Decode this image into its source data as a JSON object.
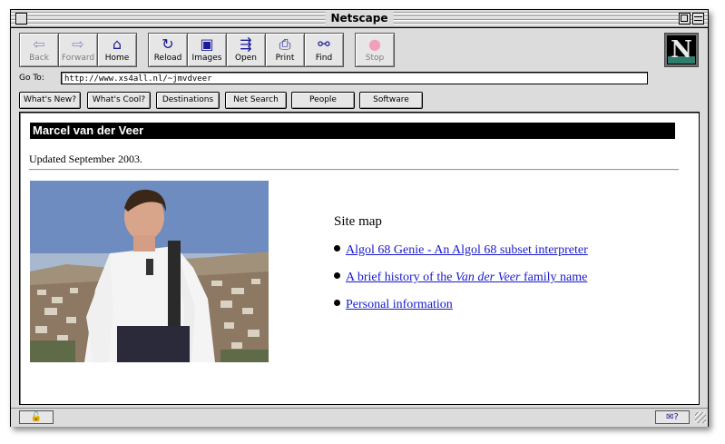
{
  "window": {
    "title": "Netscape"
  },
  "toolbar": {
    "buttons": [
      {
        "label": "Back",
        "icon": "back-arrow-icon",
        "glyph": "⇦"
      },
      {
        "label": "Forward",
        "icon": "forward-arrow-icon",
        "glyph": "⇨"
      },
      {
        "label": "Home",
        "icon": "home-icon",
        "glyph": "⌂"
      },
      {
        "label": "Reload",
        "icon": "reload-icon",
        "glyph": "↻"
      },
      {
        "label": "Images",
        "icon": "images-icon",
        "glyph": "▣"
      },
      {
        "label": "Open",
        "icon": "open-icon",
        "glyph": "⇶"
      },
      {
        "label": "Print",
        "icon": "print-icon",
        "glyph": "⎙"
      },
      {
        "label": "Find",
        "icon": "find-binoculars-icon",
        "glyph": "⚯"
      },
      {
        "label": "Stop",
        "icon": "stop-icon",
        "glyph": "●"
      }
    ],
    "logo_letter": "N"
  },
  "location": {
    "label": "Go To:",
    "url": "http://www.xs4all.nl/~jmvdveer"
  },
  "directory_buttons": [
    "What's New?",
    "What's Cool?",
    "Destinations",
    "Net Search",
    "People",
    "Software"
  ],
  "page": {
    "heading": "Marcel van der Veer",
    "updated": "Updated September 2003.",
    "sitemap_title": "Site map",
    "sitemap_links": [
      {
        "text": "Algol 68 Genie - An Algol 68 subset interpreter "
      },
      {
        "text_before": "A brief history of the ",
        "text_italic": "Van der Veer",
        "text_after": " family name "
      },
      {
        "text": "Personal information "
      }
    ]
  },
  "status": {
    "lock_glyph": "🔓",
    "mail_glyph": "✉?"
  },
  "colors": {
    "link": "#1a1acc",
    "heading_bg": "#000000",
    "chrome": "#dcdcdc",
    "stop_button": "#f0a0b8"
  }
}
